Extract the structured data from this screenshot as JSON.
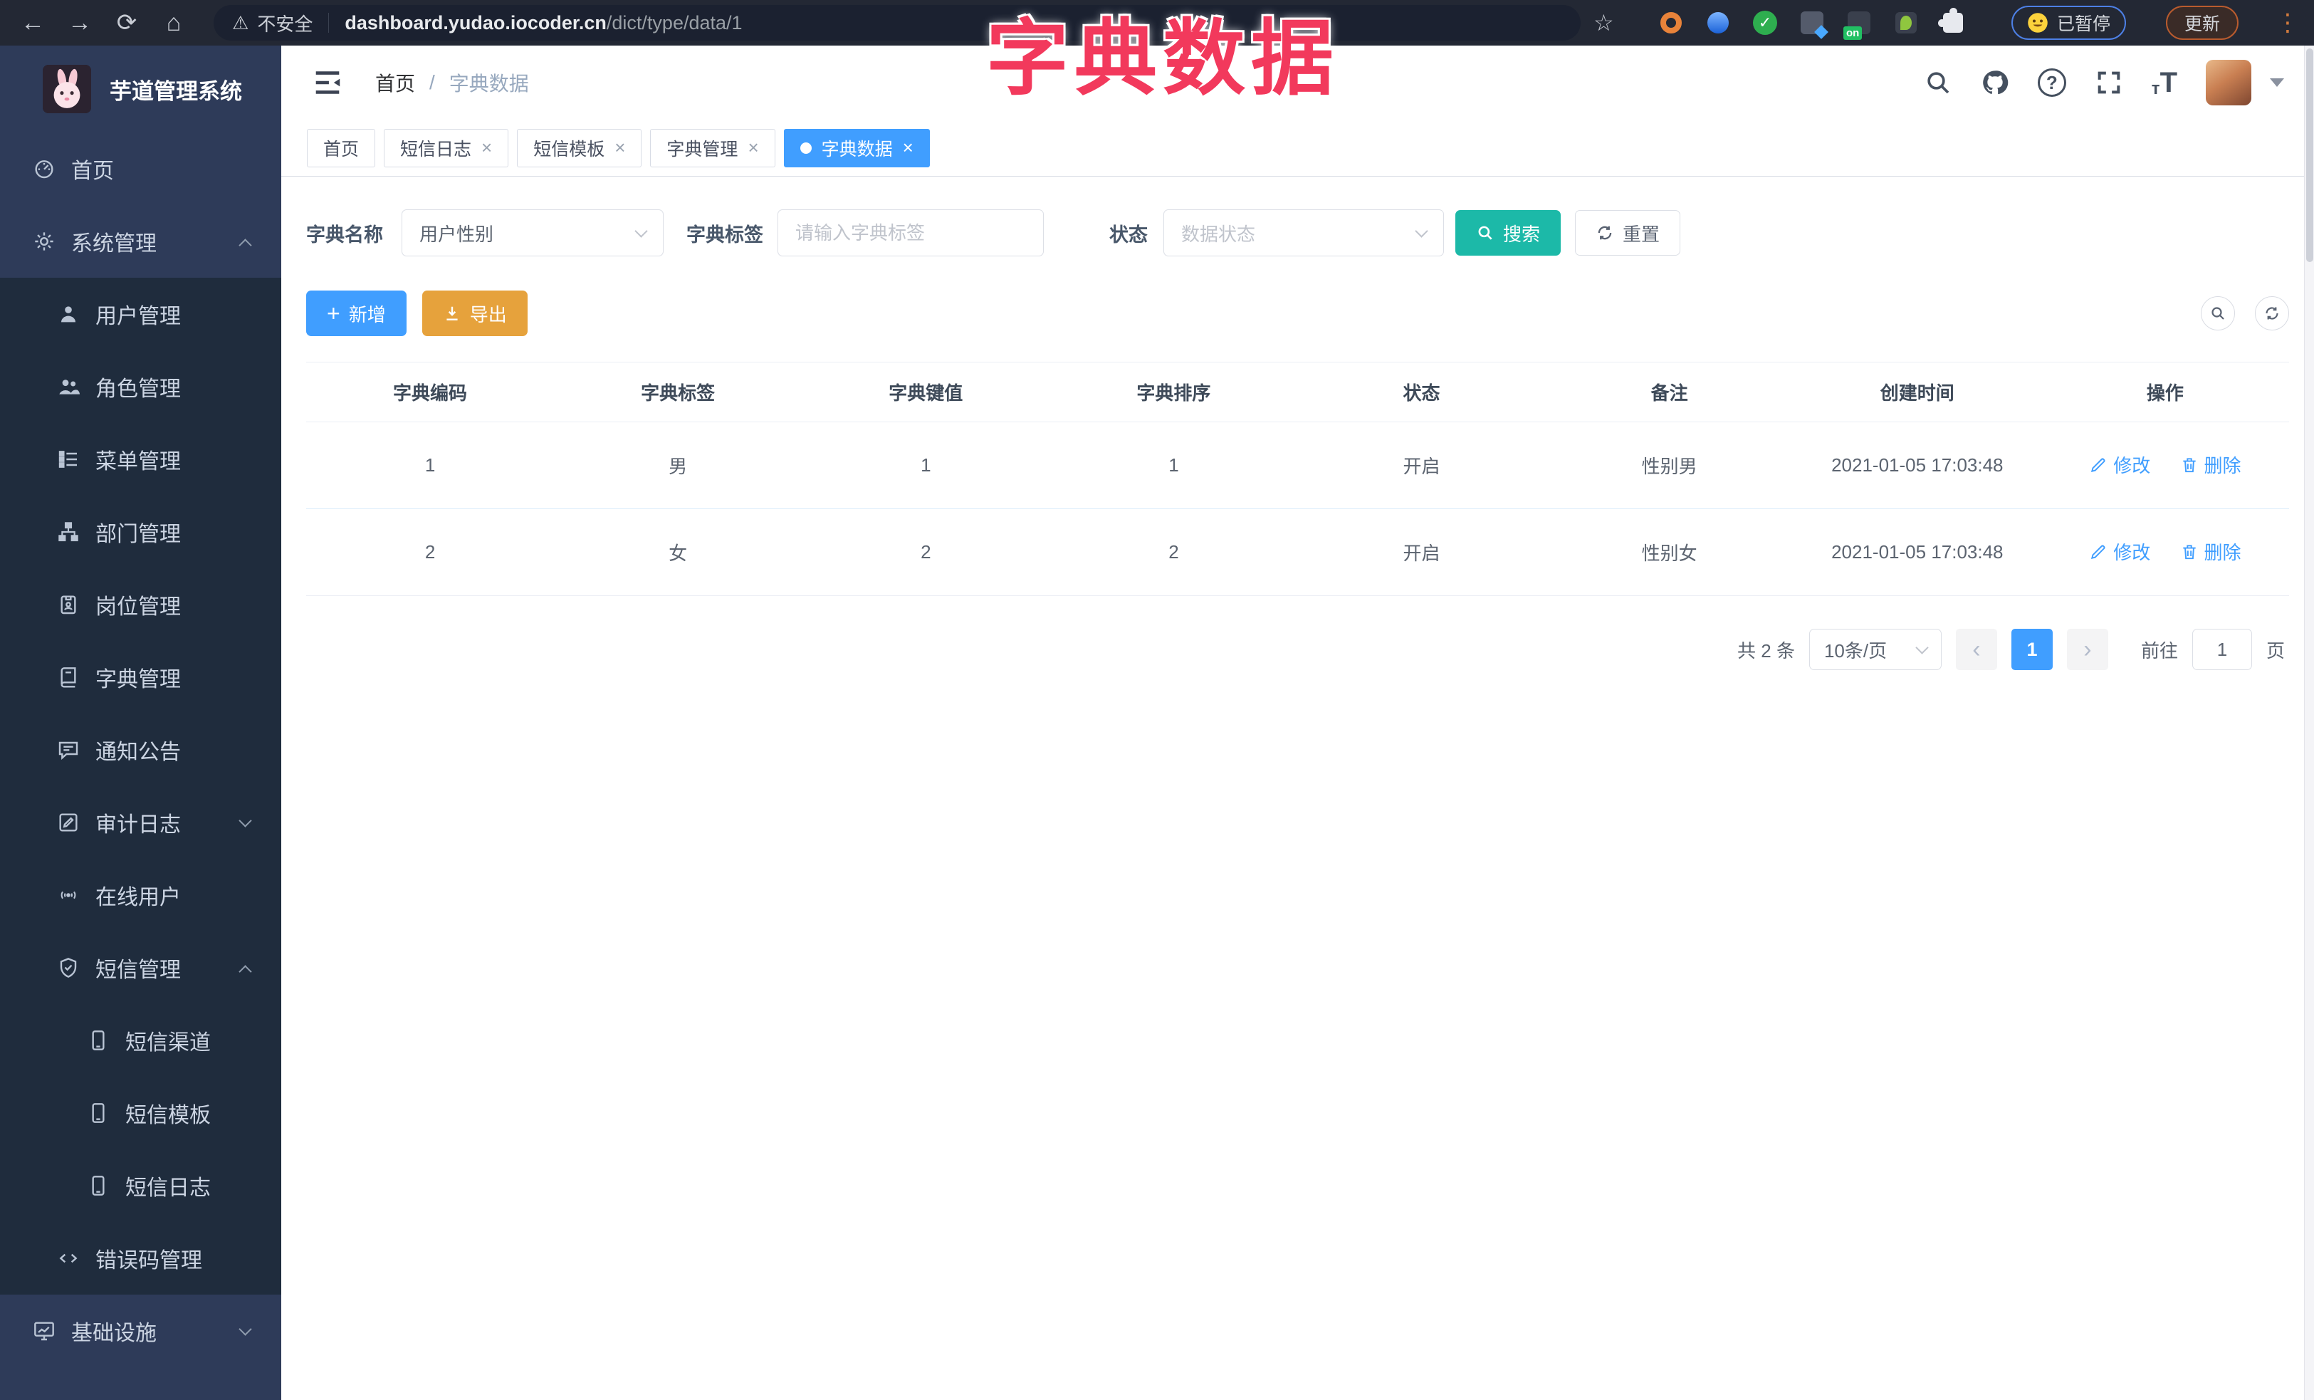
{
  "browser": {
    "security_label": "不安全",
    "url_domain": "dashboard.yudao.iocoder.cn",
    "url_path": "/dict/type/data/1",
    "profile_status": "已暂停",
    "update_label": "更新",
    "icons": {
      "back": "←",
      "forward": "→",
      "reload": "⟳",
      "home": "⌂",
      "warning": "⚠",
      "star": "☆",
      "kebab": "⋮",
      "extensions_badge": "on",
      "green_check": "✓"
    }
  },
  "overlay_title": "字典数据",
  "sidebar": {
    "app_title": "芋道管理系统",
    "items": [
      {
        "label": "首页",
        "icon": "dashboard-icon",
        "level": 0
      },
      {
        "label": "系统管理",
        "icon": "gear-icon",
        "level": 0,
        "expanded": true
      },
      {
        "label": "用户管理",
        "icon": "user-icon",
        "level": 1
      },
      {
        "label": "角色管理",
        "icon": "users-icon",
        "level": 1
      },
      {
        "label": "菜单管理",
        "icon": "menu-list-icon",
        "level": 1
      },
      {
        "label": "部门管理",
        "icon": "org-tree-icon",
        "level": 1
      },
      {
        "label": "岗位管理",
        "icon": "badge-icon",
        "level": 1
      },
      {
        "label": "字典管理",
        "icon": "book-icon",
        "level": 1
      },
      {
        "label": "通知公告",
        "icon": "message-icon",
        "level": 1
      },
      {
        "label": "审计日志",
        "icon": "edit-square-icon",
        "level": 1,
        "collapsed": true
      },
      {
        "label": "在线用户",
        "icon": "online-icon",
        "level": 1
      },
      {
        "label": "短信管理",
        "icon": "shield-check-icon",
        "level": 1,
        "expanded": true
      },
      {
        "label": "短信渠道",
        "icon": "phone-icon",
        "level": 2
      },
      {
        "label": "短信模板",
        "icon": "phone-icon",
        "level": 2
      },
      {
        "label": "短信日志",
        "icon": "phone-icon",
        "level": 2
      },
      {
        "label": "错误码管理",
        "icon": "code-icon",
        "level": 1
      },
      {
        "label": "基础设施",
        "icon": "monitor-icon",
        "level": 0,
        "collapsed": true
      }
    ]
  },
  "header": {
    "breadcrumb_home": "首页",
    "breadcrumb_sep": "/",
    "breadcrumb_current": "字典数据"
  },
  "tabs": [
    {
      "label": "首页",
      "active": false,
      "closable": false
    },
    {
      "label": "短信日志",
      "active": false,
      "closable": true
    },
    {
      "label": "短信模板",
      "active": false,
      "closable": true
    },
    {
      "label": "字典管理",
      "active": false,
      "closable": true
    },
    {
      "label": "字典数据",
      "active": true,
      "closable": true
    }
  ],
  "tab_close_glyph": "×",
  "filters": {
    "dict_name_label": "字典名称",
    "dict_name_value": "用户性别",
    "dict_label_label": "字典标签",
    "dict_label_placeholder": "请输入字典标签",
    "status_label": "状态",
    "status_placeholder": "数据状态",
    "search_label": "搜索",
    "reset_label": "重置"
  },
  "toolbar": {
    "add_label": "新增",
    "export_label": "导出",
    "plus_glyph": "+"
  },
  "table": {
    "columns": [
      "字典编码",
      "字典标签",
      "字典键值",
      "字典排序",
      "状态",
      "备注",
      "创建时间",
      "操作"
    ],
    "rows": [
      {
        "code": "1",
        "label": "男",
        "value": "1",
        "sort": "1",
        "status": "开启",
        "remark": "性别男",
        "created": "2021-01-05 17:03:48"
      },
      {
        "code": "2",
        "label": "女",
        "value": "2",
        "sort": "2",
        "status": "开启",
        "remark": "性别女",
        "created": "2021-01-05 17:03:48"
      }
    ],
    "edit_label": "修改",
    "delete_label": "删除"
  },
  "pagination": {
    "total_text": "共 2 条",
    "page_size_value": "10条/页",
    "prev_glyph": "‹",
    "next_glyph": "›",
    "current_page": "1",
    "goto_label": "前往",
    "goto_value": "1",
    "unit_label": "页"
  },
  "colors": {
    "primary": "#409EFF",
    "search_teal": "#1CB9A8",
    "export_orange": "#E6A23C",
    "overlay_red": "#F2395C",
    "sidebar_bg": "#2E3B59",
    "submenu_bg": "#1F2C3D"
  }
}
